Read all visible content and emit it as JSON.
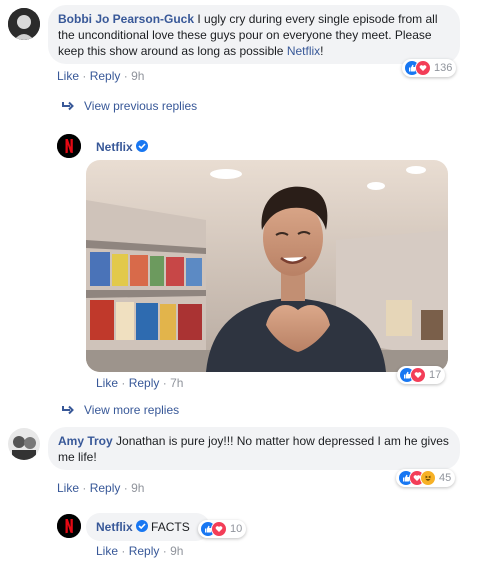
{
  "comment1": {
    "author": "Bobbi Jo Pearson-Guck",
    "text": "I ugly cry during every single episode from all the unconditional love these guys pour on everyone they meet. Please keep this show around as long as possible",
    "mention": "Netflix",
    "suffix": "!",
    "like_label": "Like",
    "reply_label": "Reply",
    "time": "9h",
    "reaction_count": "136",
    "reactions": [
      "like-icon",
      "love-icon"
    ]
  },
  "view_previous": "View previous replies",
  "reply1": {
    "author": "Netflix",
    "like_label": "Like",
    "reply_label": "Reply",
    "time": "7h",
    "reaction_count": "17",
    "reactions": [
      "like-icon",
      "love-icon"
    ]
  },
  "view_more": "View more replies",
  "comment2": {
    "author": "Amy Troy",
    "text": "Jonathan is pure joy!!! No matter how depressed I am he gives me life!",
    "like_label": "Like",
    "reply_label": "Reply",
    "time": "9h",
    "reaction_count": "45",
    "reactions": [
      "like-icon",
      "love-icon",
      "haha-icon"
    ]
  },
  "reply2": {
    "author": "Netflix",
    "text": "FACTS",
    "like_label": "Like",
    "reply_label": "Reply",
    "time": "9h",
    "reaction_count": "10",
    "reactions": [
      "like-icon",
      "love-icon"
    ]
  },
  "colors": {
    "link": "#385898",
    "bubble": "#f2f3f5",
    "netflix_red": "#e50914",
    "like": "#1877f2",
    "love": "#f33e58",
    "haha": "#f7b125"
  },
  "separator": "·"
}
